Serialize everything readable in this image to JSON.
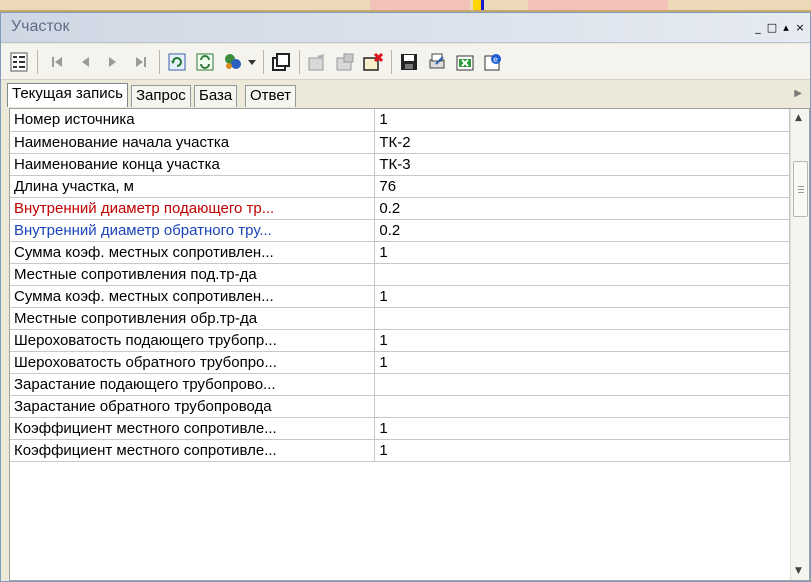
{
  "window": {
    "title": "Участок",
    "controls": [
      "_",
      "□",
      "▴",
      "×"
    ]
  },
  "toolbar": {
    "icons": [
      "fields-icon",
      "first-record-icon",
      "prev-record-icon",
      "next-record-icon",
      "last-record-icon",
      "refresh-icon",
      "sync-icon",
      "tools-icon",
      "dropdown-icon",
      "new-object-icon",
      "edit-object-icon",
      "copy-object-icon",
      "delete-object-icon",
      "save-icon",
      "print-icon",
      "export-icon",
      "internet-icon"
    ]
  },
  "tabs": [
    {
      "label": "Текущая запись",
      "active": true
    },
    {
      "label": "Запрос",
      "active": false
    },
    {
      "label": "База",
      "active": false
    },
    {
      "label": "Ответ",
      "active": false
    }
  ],
  "rows": [
    {
      "name": "Номер источника",
      "value": "1",
      "color": ""
    },
    {
      "name": "Наименование начала участка",
      "value": "ТК-2",
      "color": ""
    },
    {
      "name": "Наименование конца участка",
      "value": "ТК-3",
      "color": ""
    },
    {
      "name": "Длина участка, м",
      "value": "76",
      "color": ""
    },
    {
      "name": "Внутренний диаметр подающего тр...",
      "value": "0.2",
      "color": "red"
    },
    {
      "name": "Внутренний диаметр обратного тру...",
      "value": "0.2",
      "color": "blue"
    },
    {
      "name": "Сумма коэф. местных сопротивлен...",
      "value": "1",
      "color": ""
    },
    {
      "name": "Местные сопротивления под.тр-да",
      "value": "",
      "color": ""
    },
    {
      "name": "Сумма коэф. местных сопротивлен...",
      "value": "1",
      "color": ""
    },
    {
      "name": "Местные сопротивления обр.тр-да",
      "value": "",
      "color": ""
    },
    {
      "name": "Шероховатость подающего трубопр...",
      "value": "1",
      "color": ""
    },
    {
      "name": "Шероховатость обратного трубопро...",
      "value": "1",
      "color": ""
    },
    {
      "name": "Зарастание подающего трубопрово...",
      "value": "",
      "color": ""
    },
    {
      "name": "Зарастание обратного трубопровода",
      "value": "",
      "color": ""
    },
    {
      "name": "Коэффициент местного сопротивле...",
      "value": "1",
      "color": ""
    },
    {
      "name": "Коэффициент местного сопротивле...",
      "value": "1",
      "color": ""
    }
  ],
  "colors": {
    "red": "#c00000",
    "blue": "#1a44b8"
  }
}
